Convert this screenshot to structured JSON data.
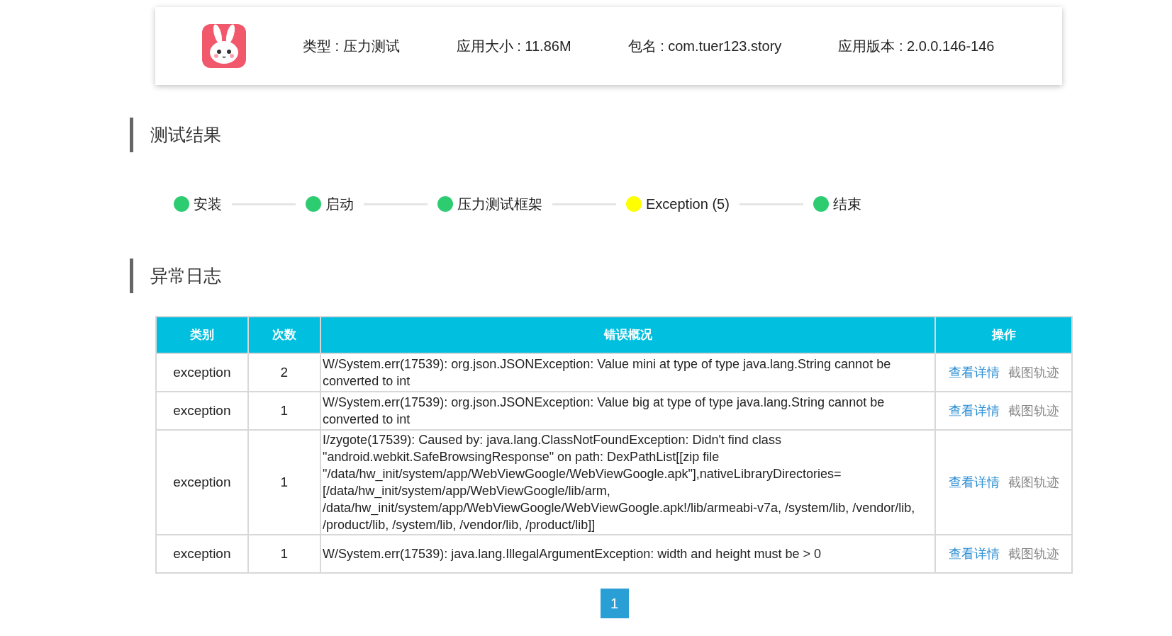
{
  "app_info": {
    "fields": [
      "类型 : 压力测试",
      "应用大小 : 11.86M",
      "包名 : com.tuer123.story",
      "应用版本 : 2.0.0.146-146"
    ]
  },
  "results": {
    "title": "测试结果",
    "steps": [
      {
        "label": "安装",
        "color": "#2ecc71"
      },
      {
        "label": "启动",
        "color": "#2ecc71"
      },
      {
        "label": "压力测试框架",
        "color": "#2ecc71"
      },
      {
        "label": "Exception (5)",
        "color": "#ffff00"
      },
      {
        "label": "结束",
        "color": "#2ecc71"
      }
    ]
  },
  "log": {
    "title": "异常日志",
    "columns": [
      "类别",
      "次数",
      "错误概况",
      "操作"
    ],
    "rows": [
      {
        "category": "exception",
        "count": "2",
        "summary": "W/System.err(17539): org.json.JSONException: Value mini at type of type java.lang.String cannot be converted to int",
        "actions": [
          "查看详情",
          "截图轨迹"
        ]
      },
      {
        "category": "exception",
        "count": "1",
        "summary": "W/System.err(17539): org.json.JSONException: Value big at type of type java.lang.String cannot be converted to int",
        "actions": [
          "查看详情",
          "截图轨迹"
        ]
      },
      {
        "category": "exception",
        "count": "1",
        "summary": "I/zygote(17539): Caused by: java.lang.ClassNotFoundException: Didn't find class \"android.webkit.SafeBrowsingResponse\" on path: DexPathList[[zip file \"/data/hw_init/system/app/WebViewGoogle/WebViewGoogle.apk\"],nativeLibraryDirectories= [/data/hw_init/system/app/WebViewGoogle/lib/arm, /data/hw_init/system/app/WebViewGoogle/WebViewGoogle.apk!/lib/armeabi-v7a, /system/lib, /vendor/lib, /product/lib, /system/lib, /vendor/lib, /product/lib]]",
        "actions": [
          "查看详情",
          "截图轨迹"
        ]
      },
      {
        "category": "exception",
        "count": "1",
        "summary": "W/System.err(17539): java.lang.IllegalArgumentException: width and height must be > 0",
        "actions": [
          "查看详情",
          "截图轨迹"
        ]
      }
    ]
  },
  "pagination": {
    "pages": [
      {
        "label": "1",
        "selected": true
      }
    ]
  }
}
